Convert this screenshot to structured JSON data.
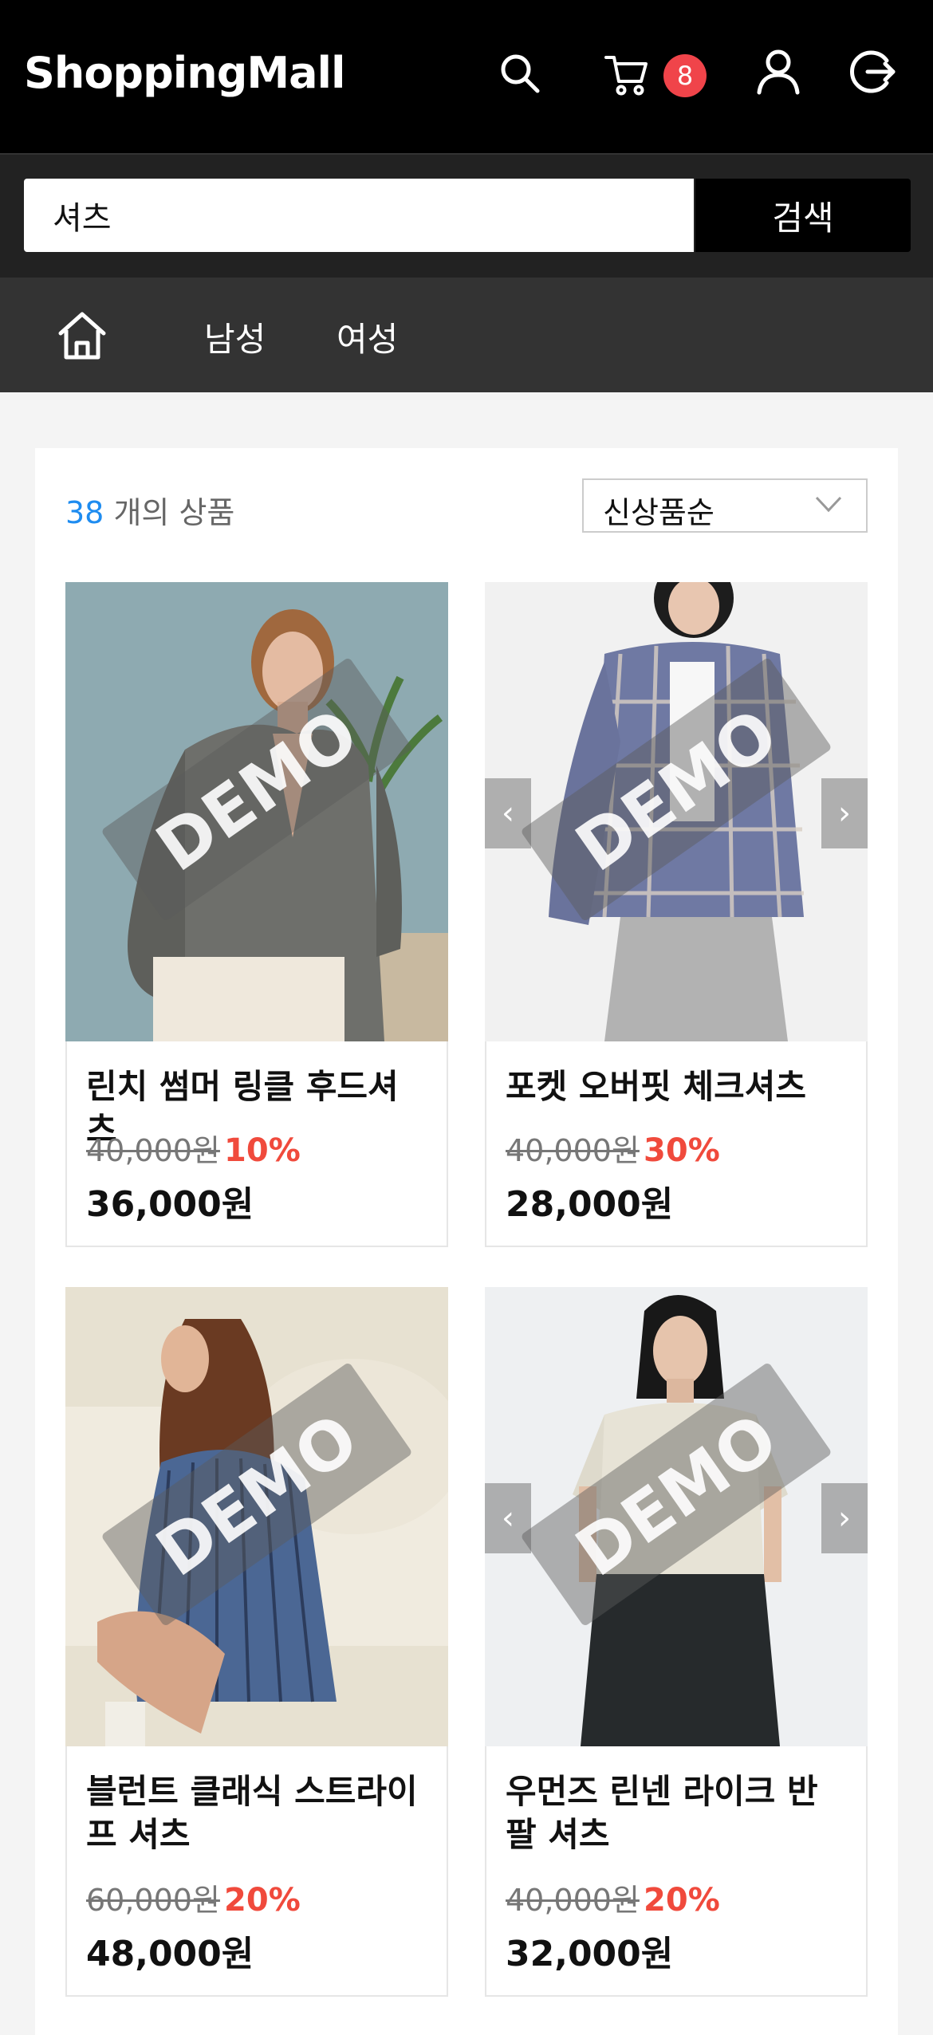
{
  "header": {
    "logo": "ShoppingMall",
    "cart_count": "8",
    "icons": [
      "search-icon",
      "cart-icon",
      "user-icon",
      "logout-icon"
    ]
  },
  "search": {
    "value": "셔츠",
    "button_label": "검색"
  },
  "nav": {
    "home_icon": "home-icon",
    "items": [
      {
        "label": "남성"
      },
      {
        "label": "여성"
      }
    ]
  },
  "results": {
    "count": "38",
    "count_suffix": "개의 상품",
    "sort_selected": "신상품순"
  },
  "products": [
    {
      "title": "린치 썸머 링클 후드셔츠",
      "original_price": "40,000원",
      "discount": "10%",
      "price": "36,000원",
      "badge": "DEMO"
    },
    {
      "title": "포켓 오버핏 체크셔츠",
      "original_price": "40,000원",
      "discount": "30%",
      "price": "28,000원",
      "badge": "DEMO"
    },
    {
      "title": "블런트 클래식 스트라이프 셔츠",
      "original_price": "60,000원",
      "discount": "20%",
      "price": "48,000원",
      "badge": "DEMO"
    },
    {
      "title": "우먼즈 린넨 라이크 반팔 셔츠",
      "original_price": "40,000원",
      "discount": "20%",
      "price": "32,000원",
      "badge": "DEMO"
    }
  ],
  "colors": {
    "header_bg": "#000000",
    "nav_bg": "#333333",
    "badge": "#f0444a",
    "discount": "#f04a3c",
    "count_accent": "#1e8cf0"
  }
}
